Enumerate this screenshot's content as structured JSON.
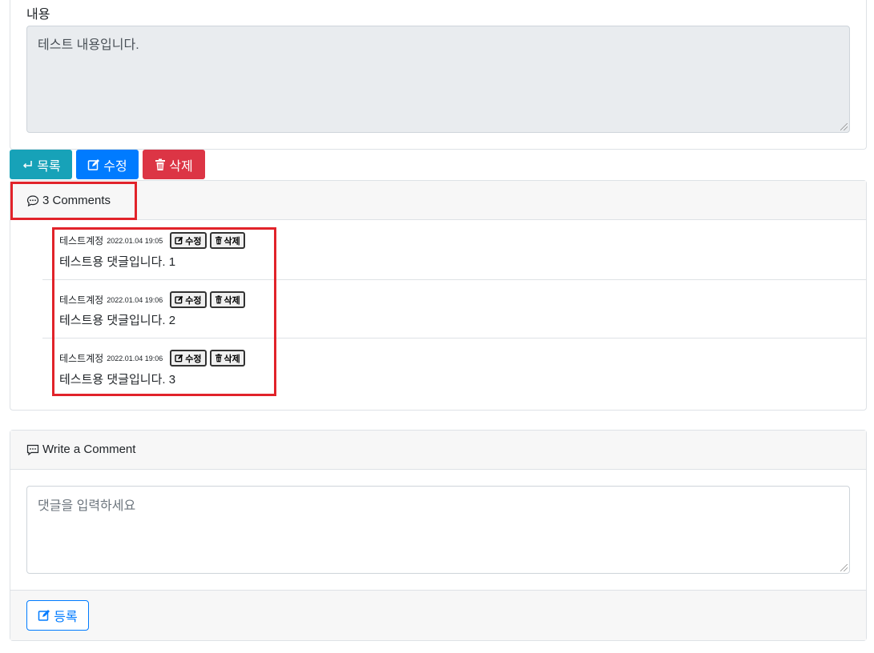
{
  "post": {
    "content_label": "내용",
    "content_text": "테스트 내용입니다."
  },
  "actions": {
    "list_label": "목록",
    "edit_label": "수정",
    "delete_label": "삭제"
  },
  "comments": {
    "count_label": "3 Comments",
    "edit_label": "수정",
    "delete_label": "삭제",
    "items": [
      {
        "author": "테스트계정",
        "date": "2022.01.04 19:05",
        "text": "테스트용 댓글입니다. 1"
      },
      {
        "author": "테스트계정",
        "date": "2022.01.04 19:06",
        "text": "테스트용 댓글입니다. 2"
      },
      {
        "author": "테스트계정",
        "date": "2022.01.04 19:06",
        "text": "테스트용 댓글입니다. 3"
      }
    ]
  },
  "write": {
    "title": "Write a Comment",
    "placeholder": "댓글을 입력하세요",
    "submit_label": "등록"
  },
  "colors": {
    "info": "#17a2b8",
    "primary": "#007bff",
    "danger": "#dc3545",
    "highlight": "#e1232a"
  },
  "icons": {
    "list": "return-arrow-icon",
    "edit": "pencil-square-icon",
    "delete": "trash-icon",
    "comments": "chat-bubble-icon",
    "write": "chat-dots-icon"
  }
}
